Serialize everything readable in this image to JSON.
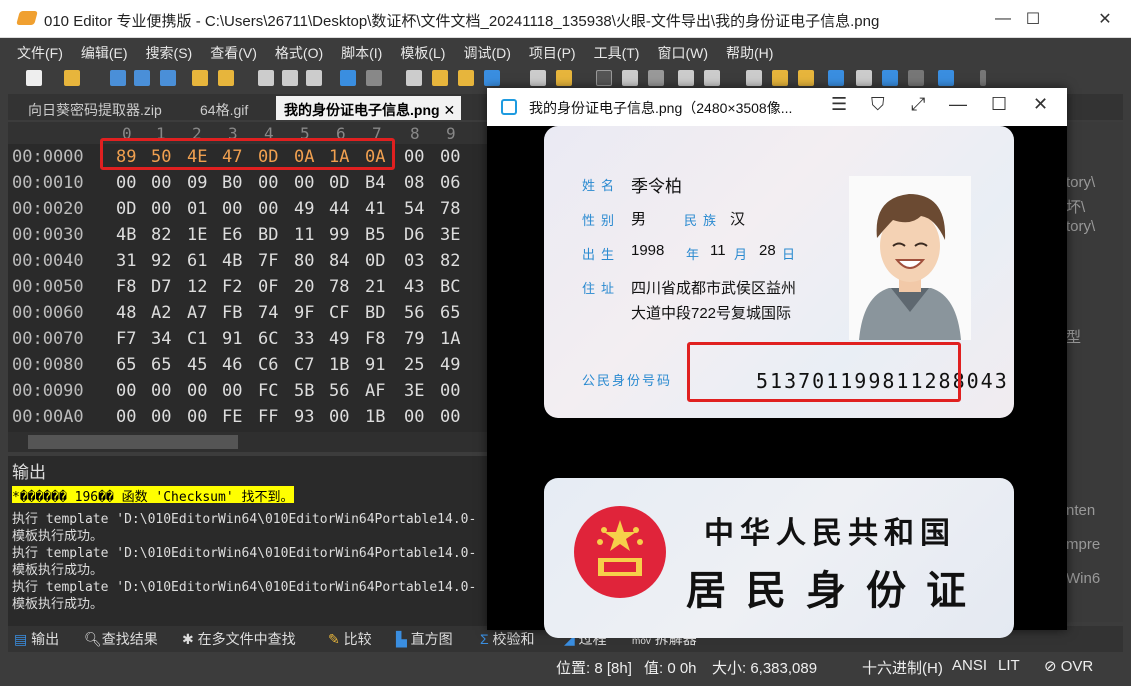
{
  "window": {
    "title": "010 Editor 专业便携版 - C:\\Users\\26711\\Desktop\\数证杯\\文件文档_20241118_135938\\火眼-文件导出\\我的身份证电子信息.png"
  },
  "menu": [
    "文件(F)",
    "编辑(E)",
    "搜索(S)",
    "查看(V)",
    "格式(O)",
    "脚本(I)",
    "模板(L)",
    "调试(D)",
    "项目(P)",
    "工具(T)",
    "窗口(W)",
    "帮助(H)"
  ],
  "tabs": [
    "向日葵密码提取器.zip",
    "64格.gif",
    "我的身份证电子信息.png"
  ],
  "hex": {
    "columns": [
      "0",
      "1",
      "2",
      "3",
      "4",
      "5",
      "6",
      "7",
      "8",
      "9"
    ],
    "rows": [
      {
        "addr": "00:0000",
        "bytes": [
          "89",
          "50",
          "4E",
          "47",
          "0D",
          "0A",
          "1A",
          "0A",
          "00",
          "00"
        ]
      },
      {
        "addr": "00:0010",
        "bytes": [
          "00",
          "00",
          "09",
          "B0",
          "00",
          "00",
          "0D",
          "B4",
          "08",
          "06"
        ]
      },
      {
        "addr": "00:0020",
        "bytes": [
          "0D",
          "00",
          "01",
          "00",
          "00",
          "49",
          "44",
          "41",
          "54",
          "78"
        ]
      },
      {
        "addr": "00:0030",
        "bytes": [
          "4B",
          "82",
          "1E",
          "E6",
          "BD",
          "11",
          "99",
          "B5",
          "D6",
          "3E"
        ]
      },
      {
        "addr": "00:0040",
        "bytes": [
          "31",
          "92",
          "61",
          "4B",
          "7F",
          "80",
          "84",
          "0D",
          "03",
          "82"
        ]
      },
      {
        "addr": "00:0050",
        "bytes": [
          "F8",
          "D7",
          "12",
          "F2",
          "0F",
          "20",
          "78",
          "21",
          "43",
          "BC"
        ]
      },
      {
        "addr": "00:0060",
        "bytes": [
          "48",
          "A2",
          "A7",
          "FB",
          "74",
          "9F",
          "CF",
          "BD",
          "56",
          "65"
        ]
      },
      {
        "addr": "00:0070",
        "bytes": [
          "F7",
          "34",
          "C1",
          "91",
          "6C",
          "33",
          "49",
          "F8",
          "79",
          "1A"
        ]
      },
      {
        "addr": "00:0080",
        "bytes": [
          "65",
          "65",
          "45",
          "46",
          "C6",
          "C7",
          "1B",
          "91",
          "25",
          "49"
        ]
      },
      {
        "addr": "00:0090",
        "bytes": [
          "00",
          "00",
          "00",
          "00",
          "FC",
          "5B",
          "56",
          "AF",
          "3E",
          "00"
        ]
      },
      {
        "addr": "00:00A0",
        "bytes": [
          "00",
          "00",
          "00",
          "FE",
          "FF",
          "93",
          "00",
          "1B",
          "00",
          "00"
        ]
      }
    ]
  },
  "output": {
    "title": "输出",
    "lines": [
      "*������ 196�� 函数 'Checksum' 找不到。",
      "执行 template 'D:\\010EditorWin64\\010EditorWin64Portable14.0-",
      "模板执行成功。",
      "执行 template 'D:\\010EditorWin64\\010EditorWin64Portable14.0-",
      "模板执行成功。",
      "执行 template 'D:\\010EditorWin64\\010EditorWin64Portable14.0-",
      "模板执行成功。"
    ]
  },
  "bottom_tabs": [
    "输出",
    "查找结果",
    "在多文件中查找",
    "比较",
    "直方图",
    "校验和",
    "过程",
    "拆解器"
  ],
  "status": {
    "position": "位置: 8 [8h]",
    "value": "值: 0 0h",
    "size": "大小: 6,383,089",
    "encoding": "十六进制(H)",
    "charset": "ANSI",
    "lit": "LIT",
    "ovr": "OVR"
  },
  "right_panel": [
    "tory\\",
    "坏\\",
    "tory\\",
    "型",
    "nten",
    "mpre",
    "Win6"
  ],
  "viewer": {
    "title": "我的身份证电子信息.png（2480×3508像...",
    "card": {
      "name_label": "姓名",
      "name": "季令柏",
      "sex_label": "性别",
      "sex": "男",
      "ethnic_label": "民族",
      "ethnic": "汉",
      "birth_label": "出生",
      "year": "1998",
      "year_label": "年",
      "month": "11",
      "month_label": "月",
      "day": "28",
      "day_label": "日",
      "addr_label": "住址",
      "addr1": "四川省成都市武侯区益州",
      "addr2": "大道中段722号复城国际",
      "id_label": "公民身份号码",
      "id": "513701199811288043"
    },
    "back": {
      "line1": "中华人民共和国",
      "line2": "居民身份证"
    }
  }
}
